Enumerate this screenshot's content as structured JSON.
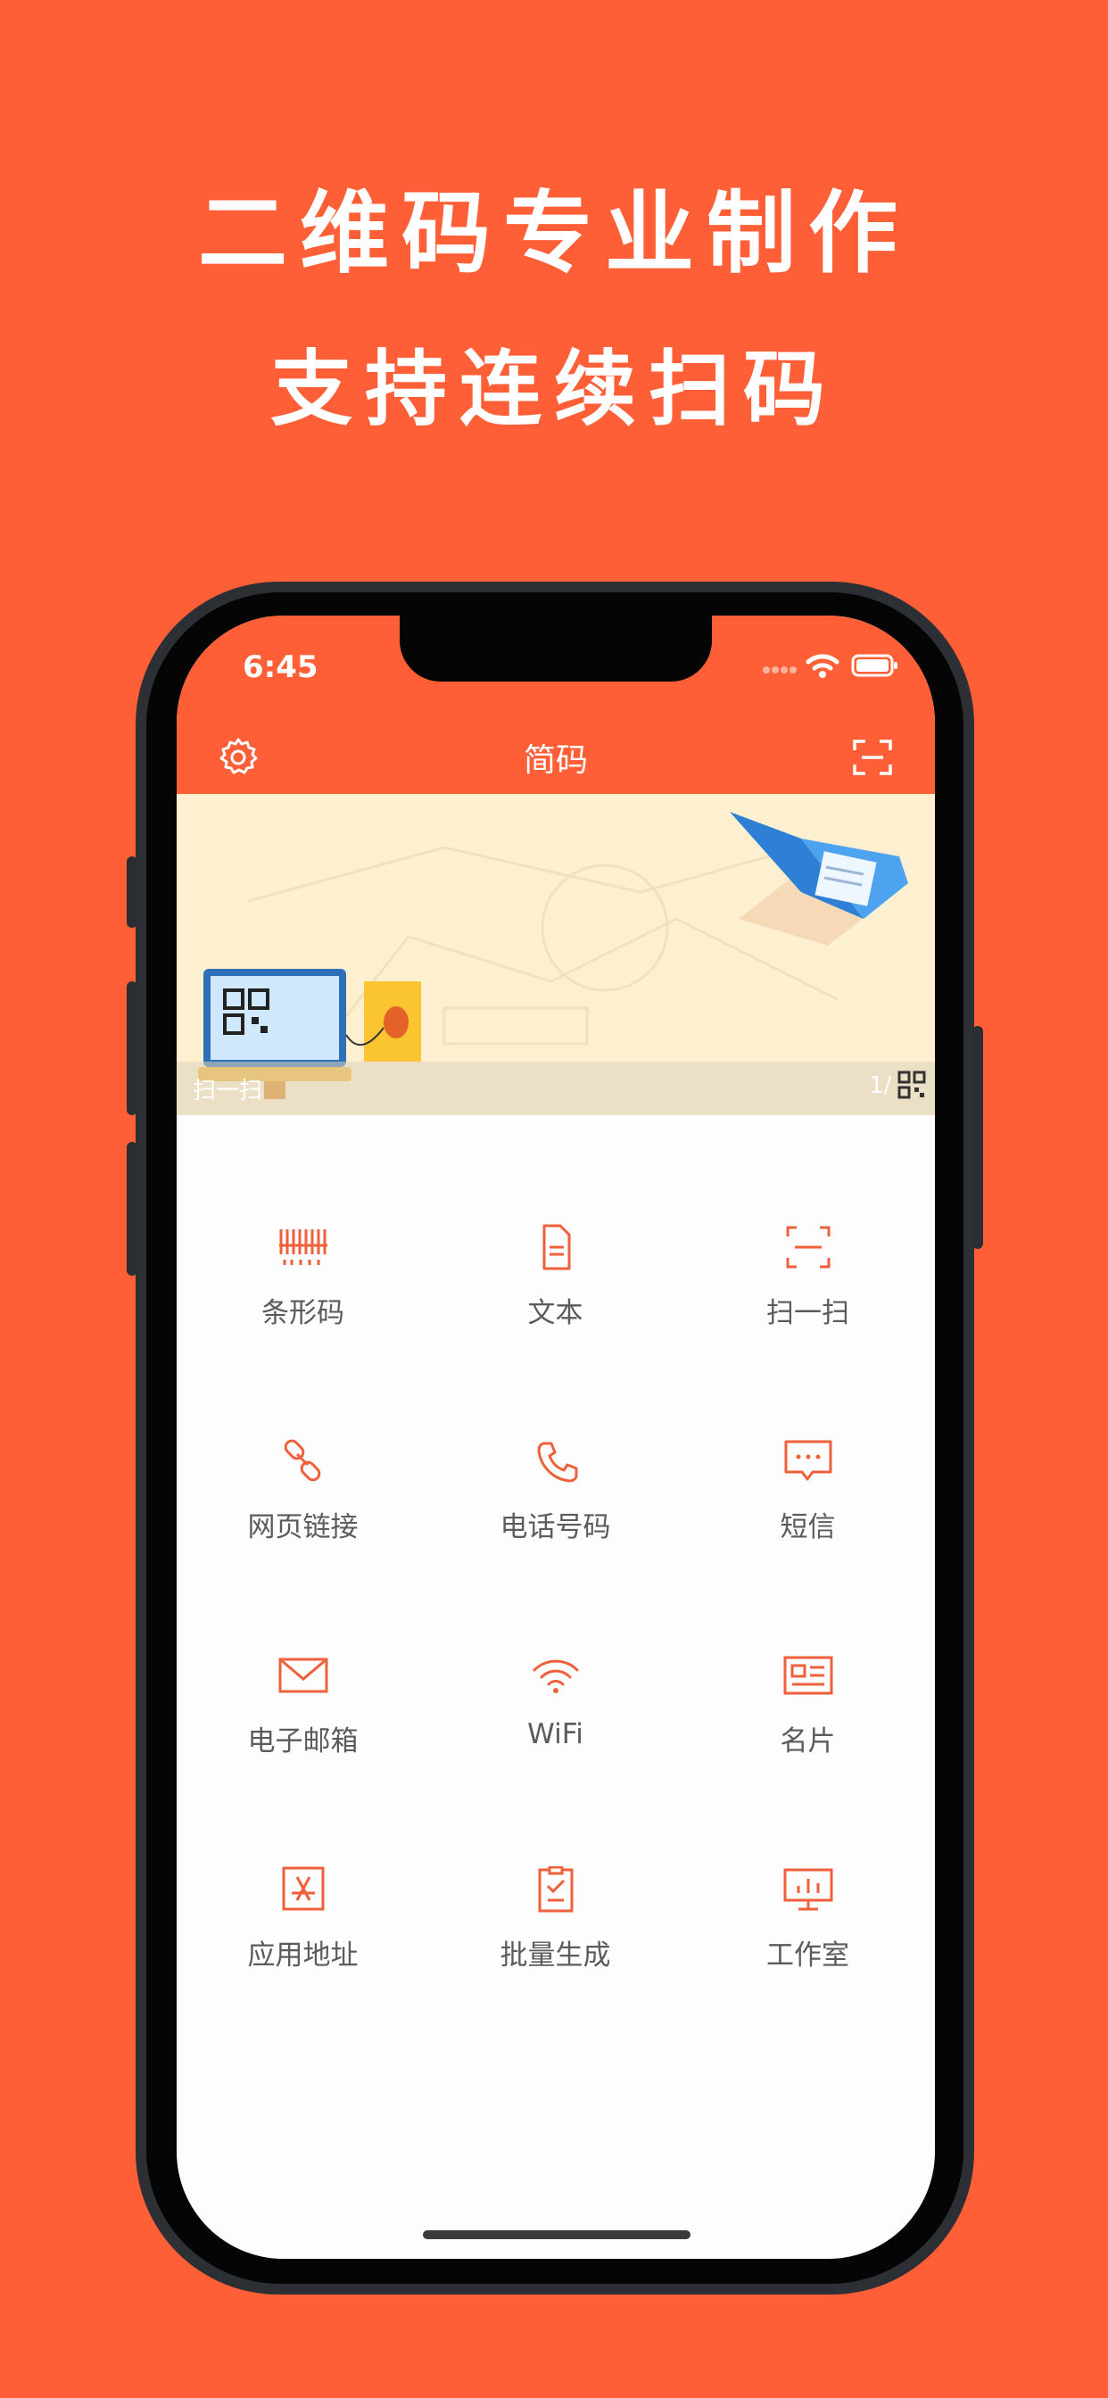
{
  "promo": {
    "headline": "二维码专业制作",
    "subheadline": "支持连续扫码"
  },
  "status_bar": {
    "time": "6:45"
  },
  "nav": {
    "title": "简码"
  },
  "banner": {
    "caption": "扫一扫",
    "pager": "1/"
  },
  "grid": [
    {
      "label": "条形码",
      "icon": "barcode-icon"
    },
    {
      "label": "文本",
      "icon": "document-icon"
    },
    {
      "label": "扫一扫",
      "icon": "scan-icon"
    },
    {
      "label": "网页链接",
      "icon": "link-icon"
    },
    {
      "label": "电话号码",
      "icon": "phone-icon"
    },
    {
      "label": "短信",
      "icon": "message-icon"
    },
    {
      "label": "电子邮箱",
      "icon": "mail-icon"
    },
    {
      "label": "WiFi",
      "icon": "wifi-icon"
    },
    {
      "label": "名片",
      "icon": "card-icon"
    },
    {
      "label": "应用地址",
      "icon": "app-store-icon"
    },
    {
      "label": "批量生成",
      "icon": "checklist-icon"
    },
    {
      "label": "工作室",
      "icon": "presentation-icon"
    }
  ],
  "colors": {
    "accent": "#FF5F37",
    "icon": "#F0603A",
    "banner": "#FDF0D0"
  }
}
